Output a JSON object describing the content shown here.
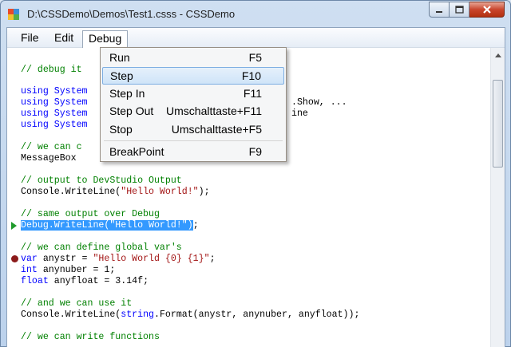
{
  "window": {
    "title": "D:\\CSSDemo\\Demos\\Test1.csss - CSSDemo"
  },
  "menubar": {
    "items": [
      "File",
      "Edit",
      "Debug"
    ]
  },
  "debug_menu": {
    "items": [
      {
        "label": "Run",
        "shortcut": "F5"
      },
      {
        "label": "Step",
        "shortcut": "F10"
      },
      {
        "label": "Step In",
        "shortcut": "F11"
      },
      {
        "label": "Step Out",
        "shortcut": "Umschalttaste+F11"
      },
      {
        "label": "Stop",
        "shortcut": "Umschalttaste+F5"
      },
      {
        "label": "BreakPoint",
        "shortcut": "F9"
      }
    ]
  },
  "code": {
    "l1": "// debug it",
    "l2": "using System",
    "l3": "using System",
    "l3b": ".Show, ...",
    "l4": "using System",
    "l4b": "ine",
    "l5": "using System",
    "l6": "// we can c",
    "l7": "MessageBox",
    "l8": "// output to DevStudio Output",
    "l9a": "Console.WriteLine(",
    "l9b": "\"Hello World!\"",
    "l9c": ");",
    "l10": "// same output over Debug",
    "l11a": "Debug.WriteLine(\"Hello World!\")",
    "l11b": ";",
    "l12": "// we can define global var's",
    "l13a": "var",
    "l13b": " anystr = ",
    "l13c": "\"Hello World {0} {1}\"",
    "l13d": ";",
    "l14a": "int",
    "l14b": " anynuber = 1;",
    "l15a": "float",
    "l15b": " anyfloat = 3.14f;",
    "l16": "// and we can use it",
    "l17a": "Console.WriteLine(",
    "l17b": "string",
    "l17c": ".Format(anystr, anynuber, anyfloat));",
    "l18": "// we can write functions"
  },
  "colors": {
    "comment": "#008000",
    "keyword": "#0000ff",
    "string": "#a31515",
    "selection": "#3399ff"
  }
}
